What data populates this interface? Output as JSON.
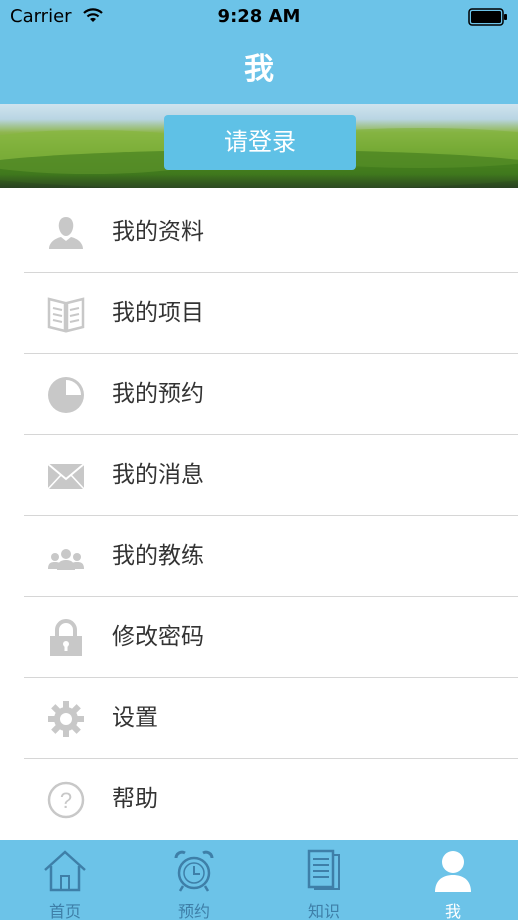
{
  "status_bar": {
    "carrier": "Carrier",
    "time": "9:28 AM"
  },
  "nav": {
    "title": "我"
  },
  "login": {
    "label": "请登录"
  },
  "menu": [
    {
      "label": "我的资料",
      "icon": "person-icon"
    },
    {
      "label": "我的项目",
      "icon": "book-icon"
    },
    {
      "label": "我的预约",
      "icon": "pie-clock-icon"
    },
    {
      "label": "我的消息",
      "icon": "envelope-icon"
    },
    {
      "label": "我的教练",
      "icon": "group-icon"
    },
    {
      "label": "修改密码",
      "icon": "lock-icon"
    },
    {
      "label": "设置",
      "icon": "gear-icon"
    },
    {
      "label": "帮助",
      "icon": "help-circle-icon"
    }
  ],
  "tabs": [
    {
      "label": "首页",
      "icon": "home-icon"
    },
    {
      "label": "预约",
      "icon": "alarm-clock-icon"
    },
    {
      "label": "知识",
      "icon": "document-icon"
    },
    {
      "label": "我",
      "icon": "profile-icon",
      "active": true
    }
  ],
  "colors": {
    "accent": "#6cc3e8",
    "button": "#5fc1e6",
    "icon_gray": "#c8c8c8",
    "tab_inactive": "#3e7fa8"
  }
}
